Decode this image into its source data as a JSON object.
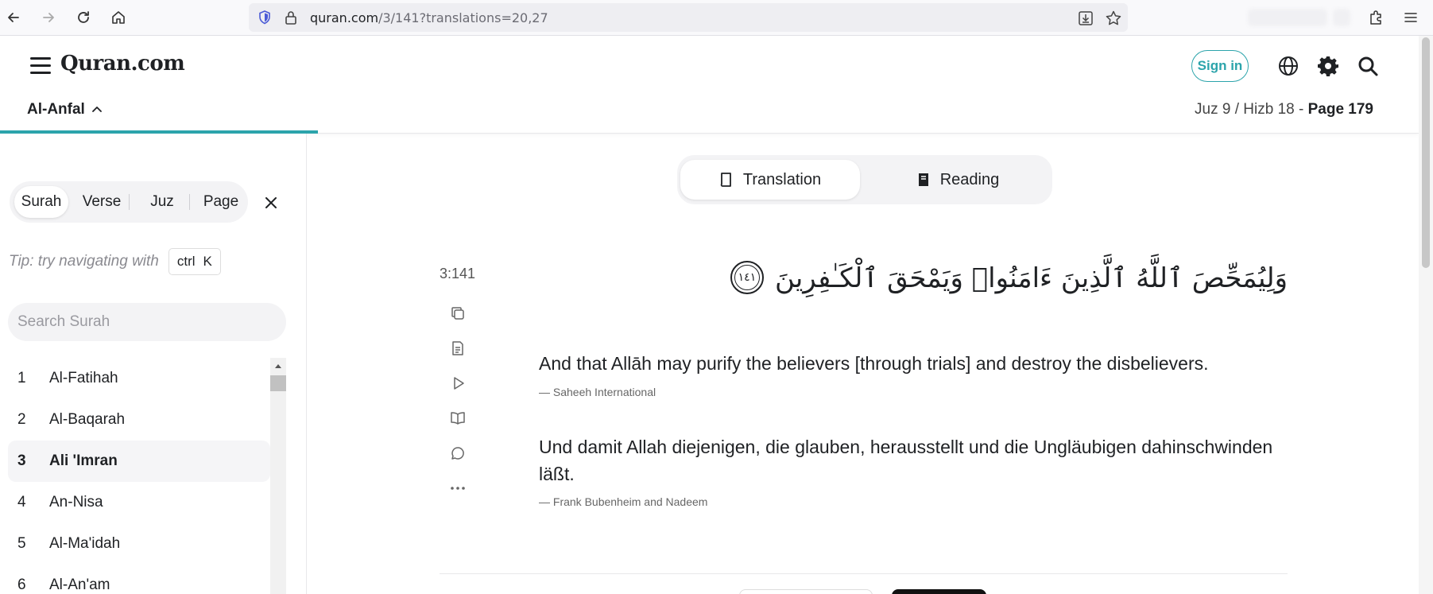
{
  "browser": {
    "url_host": "quran.com",
    "url_path": "/3/141?translations=20,27"
  },
  "header": {
    "logo": "Quran.com",
    "signin_label": "Sign in",
    "surah_name": "Al-Anfal",
    "page_info_prefix": "Juz 9 / Hizb 18 - ",
    "page_info_bold": "Page 179"
  },
  "sidebar": {
    "tabs": [
      "Surah",
      "Verse",
      "Juz",
      "Page"
    ],
    "active_tab": "Surah",
    "tip": "Tip: try navigating with",
    "kbd_ctrl": "ctrl",
    "kbd_key": "K",
    "search_placeholder": "Search Surah",
    "surahs": [
      {
        "num": "1",
        "name": "Al-Fatihah"
      },
      {
        "num": "2",
        "name": "Al-Baqarah"
      },
      {
        "num": "3",
        "name": "Ali 'Imran"
      },
      {
        "num": "4",
        "name": "An-Nisa"
      },
      {
        "num": "5",
        "name": "Al-Ma'idah"
      },
      {
        "num": "6",
        "name": "Al-An'am"
      }
    ],
    "active_surah": "3"
  },
  "mode": {
    "translation_label": "Translation",
    "reading_label": "Reading",
    "active": "Translation"
  },
  "verse": {
    "key": "3:141",
    "arabic": "وَلِيُمَحِّصَ ٱللَّهُ ٱلَّذِينَ ءَامَنُوا۟ وَيَمْحَقَ ٱلْكَـٰفِرِينَ",
    "ayah_number": "١٤١",
    "translations": [
      {
        "text": "And that Allāh may purify the believers [through trials] and destroy the disbelievers.",
        "source": "— Saheeh International"
      },
      {
        "text": "Und damit Allah diejenigen, die glauben, herausstellt und die Ungläubigen dahinschwinden läßt.",
        "source": "— Frank Bubenheim and Nadeem"
      }
    ]
  },
  "colors": {
    "accent": "#2ca4ab"
  }
}
